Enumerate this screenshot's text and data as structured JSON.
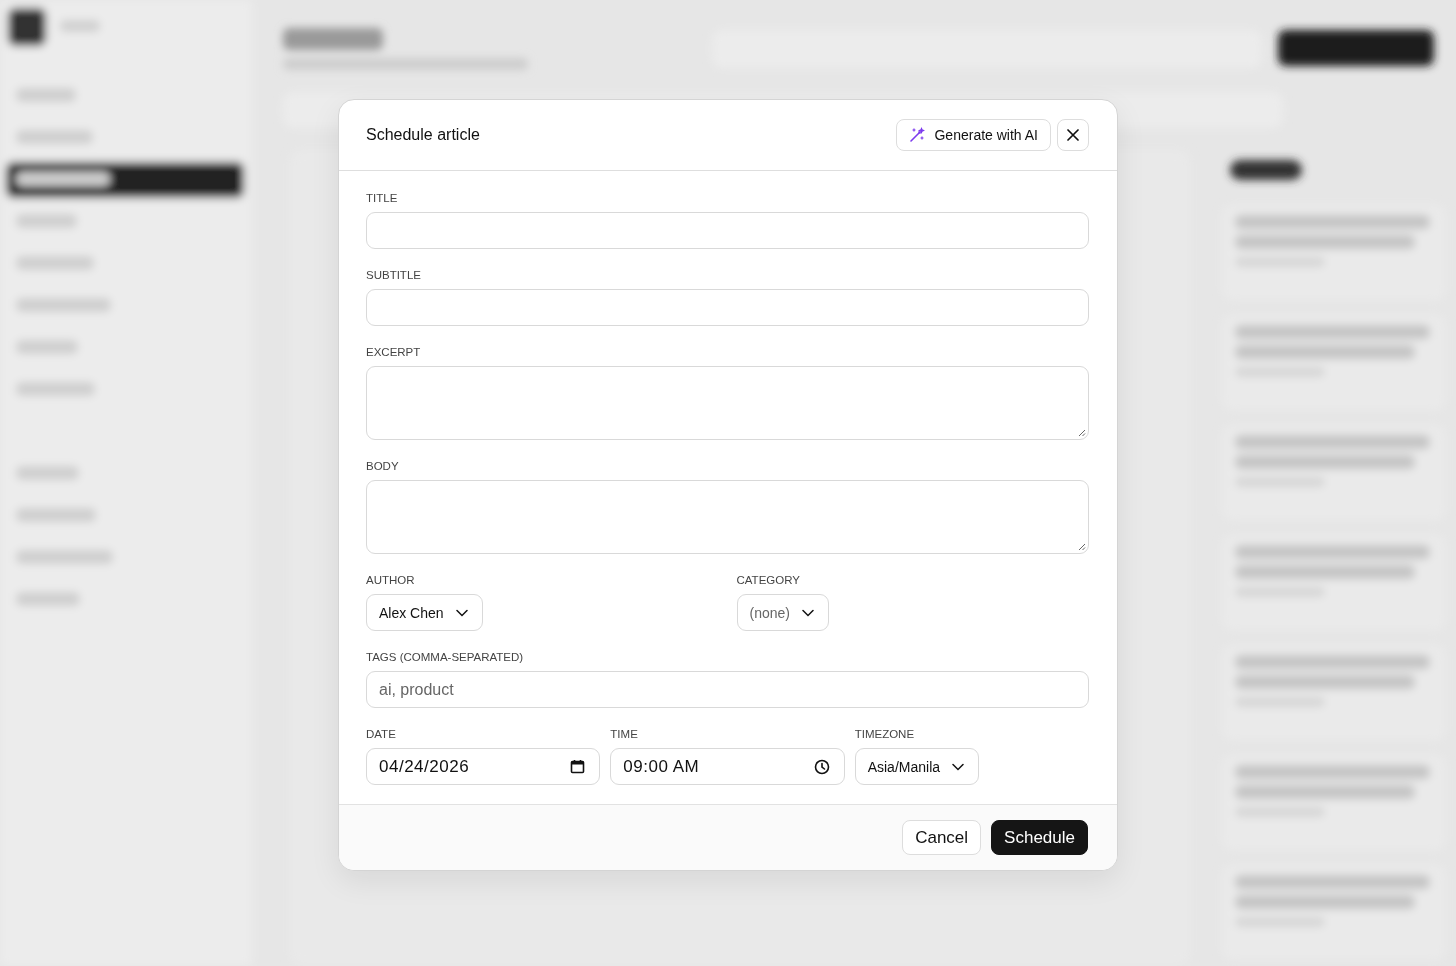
{
  "dialog": {
    "title": "Schedule article",
    "ai_button": "Generate with AI",
    "rows": [
      [
        {
          "kind": "text",
          "label": "TITLE"
        }
      ],
      [
        {
          "kind": "text",
          "label": "SUBTITLE"
        }
      ],
      [
        {
          "kind": "textarea",
          "label": "EXCERPT"
        }
      ],
      [
        {
          "kind": "textarea",
          "label": "BODY"
        }
      ],
      [
        {
          "kind": "select",
          "label": "AUTHOR",
          "value": "Alex Chen"
        },
        {
          "kind": "select",
          "label": "CATEGORY",
          "placeholder": "(none)"
        }
      ],
      [
        {
          "kind": "text",
          "label": "TAGS (COMMA-SEPARATED)",
          "placeholder": "ai, product"
        }
      ],
      [
        {
          "kind": "date",
          "label": "DATE",
          "value": "04/24/2026"
        },
        {
          "kind": "time",
          "label": "TIME",
          "value": "09:00 AM"
        },
        {
          "kind": "select",
          "label": "TIMEZONE",
          "value": "Asia/Manila"
        }
      ]
    ],
    "buttons": [
      {
        "kind": "secondary",
        "label": "Cancel"
      },
      {
        "kind": "primary",
        "label": "Schedule"
      }
    ]
  }
}
